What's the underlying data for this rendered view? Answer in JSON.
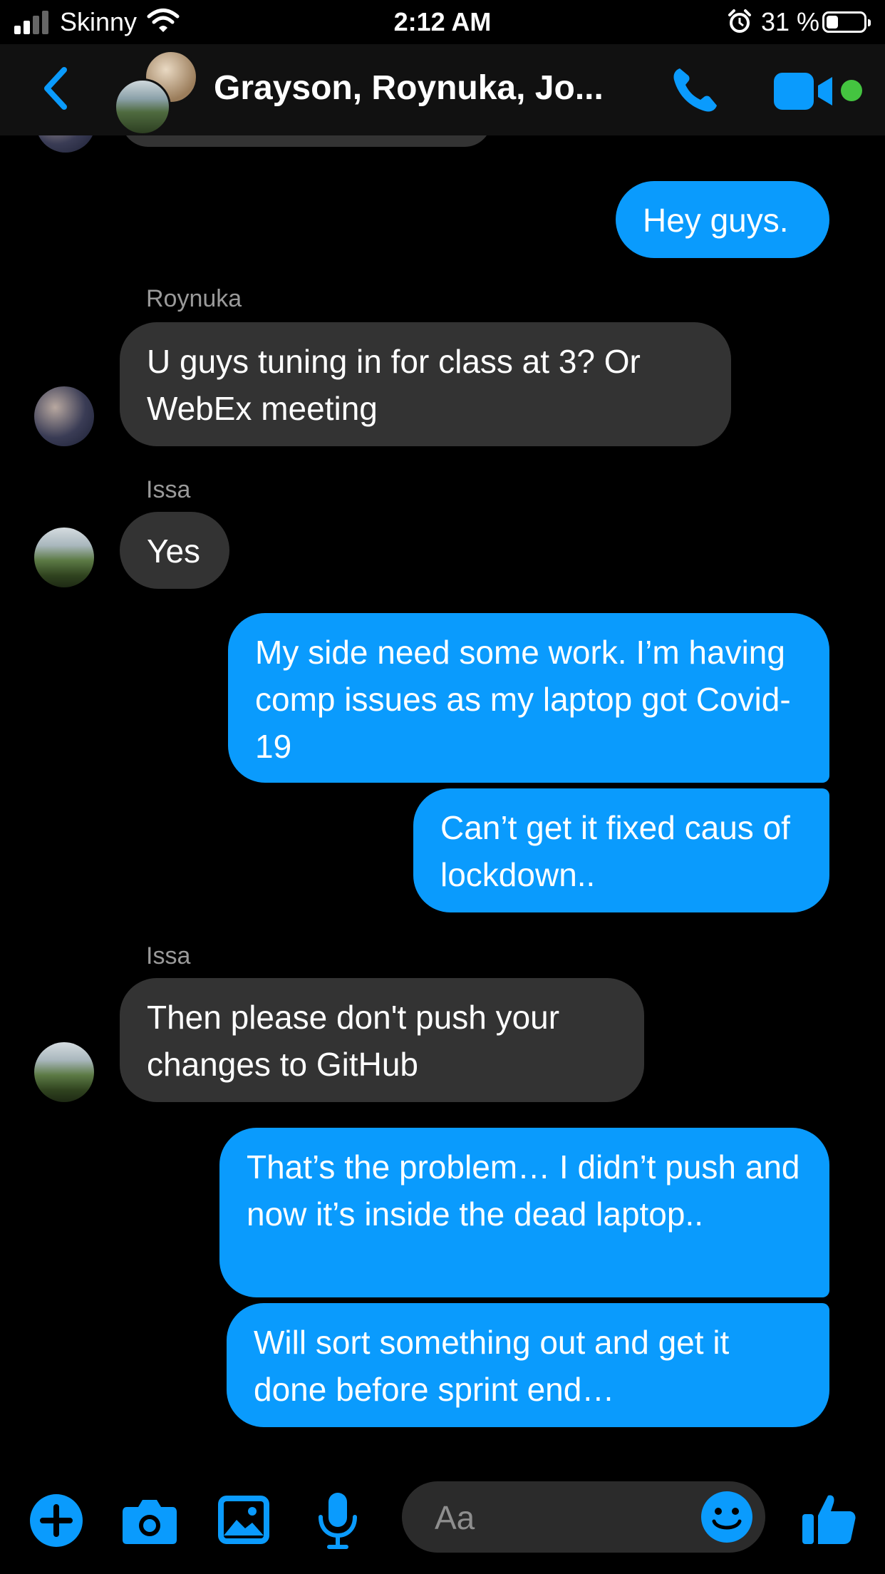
{
  "status_bar": {
    "carrier": "Skinny",
    "time": "2:12 AM",
    "battery_percent": "31 %",
    "battery_level": 0.31
  },
  "header": {
    "title": "Grayson, Roynuka, Jo...",
    "accent_color": "#0a9bfd",
    "online_indicator_color": "#44c440"
  },
  "messages": [
    {
      "direction": "outgoing",
      "text": "Hey guys."
    },
    {
      "direction": "incoming",
      "sender": "Roynuka",
      "text": "U guys tuning in for class at 3? Or WebEx meeting"
    },
    {
      "direction": "incoming",
      "sender": "Issa",
      "text": "Yes"
    },
    {
      "direction": "outgoing",
      "text": "My side need some work. I’m having comp issues as my laptop got Covid-19"
    },
    {
      "direction": "outgoing",
      "text": "Can’t get it fixed caus of lockdown.."
    },
    {
      "direction": "incoming",
      "sender": "Issa",
      "text": "Then please don't push your changes to GitHub"
    },
    {
      "direction": "outgoing",
      "text": "That’s the problem… I didn’t push and now it’s inside the dead laptop.."
    },
    {
      "direction": "outgoing",
      "text": "Will sort something out and get it done before sprint end…"
    }
  ],
  "composer": {
    "placeholder": "Aa",
    "icons": [
      "plus-icon",
      "camera-icon",
      "image-icon",
      "microphone-icon",
      "emoji-icon",
      "thumbs-up-icon"
    ]
  }
}
